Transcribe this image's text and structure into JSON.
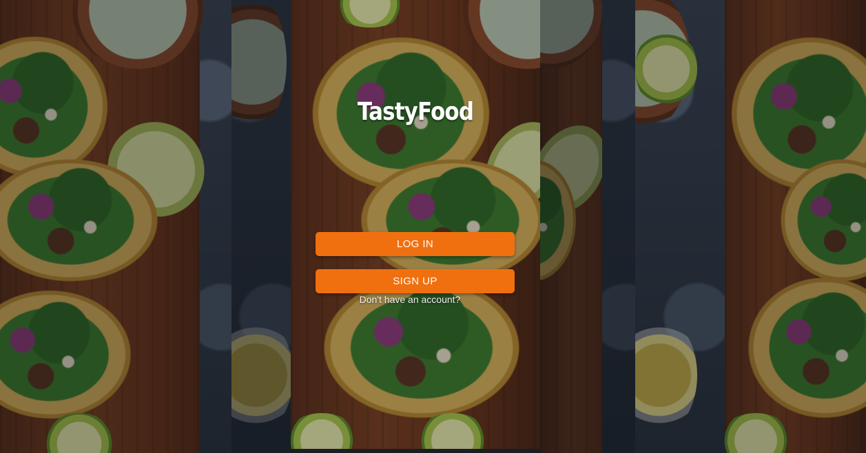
{
  "app": {
    "logo_text": "TastyFood"
  },
  "actions": {
    "login_label": "LOG IN",
    "signup_label": "SIGN UP",
    "signup_hint": "Don't have an account?"
  },
  "colors": {
    "accent": "#f07010",
    "text_on_accent": "#ffffff"
  }
}
